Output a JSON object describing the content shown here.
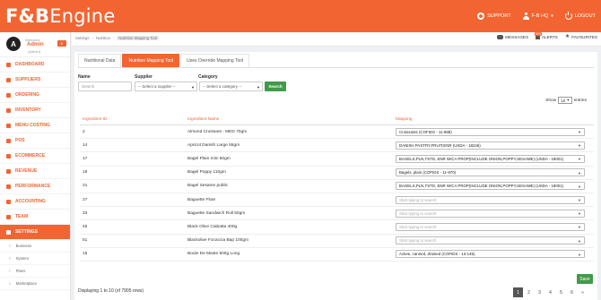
{
  "brand": {
    "logo_mark": "F&B",
    "logo_text": "Engine"
  },
  "topbar": {
    "support": "SUPPORT",
    "hq": "F-B HQ",
    "logout": "LOGOUT"
  },
  "profile": {
    "avatar_letter": "A",
    "welcome": "Welcome",
    "name": "Admin",
    "role": "(Admin)",
    "edit": "E"
  },
  "sidebar": {
    "items": [
      {
        "label": "DASHBOARD"
      },
      {
        "label": "SUPPLIERS"
      },
      {
        "label": "ORDERING"
      },
      {
        "label": "INVENTORY"
      },
      {
        "label": "MENU COSTING"
      },
      {
        "label": "POS"
      },
      {
        "label": "ECOMMERCE"
      },
      {
        "label": "REVENUE"
      },
      {
        "label": "PERFORMANCE"
      },
      {
        "label": "ACCOUNTING"
      },
      {
        "label": "TEAM"
      },
      {
        "label": "SETTINGS"
      }
    ],
    "subitems": [
      {
        "label": "Business"
      },
      {
        "label": "System"
      },
      {
        "label": "Plans"
      },
      {
        "label": "Marketplace"
      }
    ]
  },
  "breadcrumb": {
    "items": [
      "Settings",
      "Nutrition",
      "Nutrition Mapping Tool"
    ]
  },
  "header_links": {
    "messages": "MESSAGES",
    "alerts": "ALERTS",
    "alerts_badge": "999",
    "favourites": "FAVOURITES"
  },
  "tabs": [
    {
      "label": "Nutritional Data"
    },
    {
      "label": "Nutrition Mapping Tool"
    },
    {
      "label": "Uses Override Mapping Tool"
    }
  ],
  "filters": {
    "name_label": "Name",
    "name_placeholder": "Search",
    "supplier_label": "Supplier",
    "supplier_value": "-- Select a supplier --",
    "category_label": "Category",
    "category_value": "-- Select a category --",
    "search_button": "Search"
  },
  "show": {
    "prefix": "Show",
    "value": "10",
    "suffix": "entries"
  },
  "table": {
    "headers": {
      "id": "Ingredient ID",
      "name": "Ingredient Name",
      "mapping": "Mapping"
    },
    "rows": [
      {
        "id": "2",
        "name": "Almond Croissant - MED 70gm",
        "mapping": "Croissants (COFIDS - 11-988)",
        "placeholder": false
      },
      {
        "id": "14",
        "name": "Apricot Danish Large 55gm",
        "mapping": "DANISH PASTRY,FRUIT,ENR (USDA - 18246)",
        "placeholder": false
      },
      {
        "id": "17",
        "name": "Bagel Plain mini 60gm",
        "mapping": "BAGELS,PLN,TSTD, ENR W/CA PROP(INCLUDE ONION,POPPY,SESAME) (USDA - 18001)",
        "placeholder": false
      },
      {
        "id": "18",
        "name": "Bagel Poppy 110gm",
        "mapping": "Bagels, plain (COFIDS - 11-970)",
        "placeholder": false
      },
      {
        "id": "21",
        "name": "Bagel Sesame public",
        "mapping": "BAGELS,PLN,TSTD, ENR W/CA PROP(INCLUDE ONION,POPPY,SESAME) (USDA - 18001)",
        "placeholder": false
      },
      {
        "id": "27",
        "name": "Baguette Flute",
        "mapping": "Start typing to search",
        "placeholder": true
      },
      {
        "id": "33",
        "name": "Baguette Sandwich Roll 50gm",
        "mapping": "Start typing to search",
        "placeholder": true
      },
      {
        "id": "45",
        "name": "Black Olive Ciabatta 400g",
        "mapping": "Start typing to search",
        "placeholder": true
      },
      {
        "id": "51",
        "name": "Blackolive Focaccia Bap 100gm",
        "mapping": "Start typing to search",
        "placeholder": true
      },
      {
        "id": "15",
        "name": "Boule De Maste 500g Long",
        "mapping": "Ackee, canned, drained (COFIDS - 13-145)",
        "placeholder": false
      }
    ]
  },
  "save_button": "Save",
  "footer": {
    "info": "Displaying 1 to 10 (of 7905 rows)"
  },
  "pager": {
    "pages": [
      "1",
      "2",
      "3",
      "4",
      "5",
      "6",
      "»"
    ],
    "active": "1"
  },
  "colors": {
    "accent": "#f26532",
    "success": "#3f9c47"
  }
}
